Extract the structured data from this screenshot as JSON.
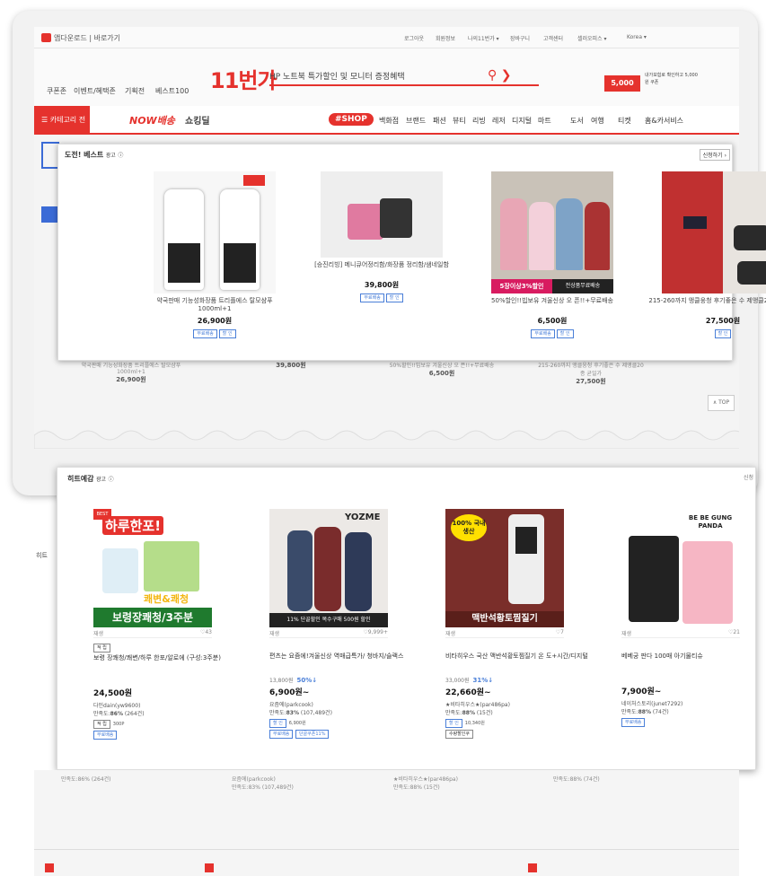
{
  "site": {
    "app_label": "앱다운로드 | 바로가기",
    "top_links": [
      "로그아웃",
      "회원정보",
      "나의11번가 ▾",
      "장바구니",
      "고객센터",
      "셀러오피스 ▾",
      "Korea ▾"
    ],
    "quick_links": [
      "쿠폰존",
      "이벤트/혜택존",
      "기획전",
      "베스트100"
    ],
    "brand": "11번가",
    "promo_text": "HP 노트북 특가할인 및 모니터 증정혜택",
    "coupon_value": "5,000",
    "coupon_text": "내가보험로 확인하고 5,000원 쿠폰",
    "nav": {
      "category_all": "카테고리 전체",
      "now": "NOW배송",
      "shopping": "쇼킹딜",
      "shop_tag": "#SHOP",
      "items": [
        "백화점",
        "브랜드",
        "패션",
        "뷰티",
        "리빙",
        "레저",
        "디지털",
        "마트",
        "도서",
        "여행",
        "티켓",
        "홈&카서비스"
      ]
    },
    "top_button": "∧ TOP"
  },
  "best": {
    "title": "도전! 베스트",
    "ad_label": "광고",
    "apply": "신청하기 ›",
    "items": [
      {
        "name": "약국판매 기능성화장품 트리플에스 탈모샴푸1000ml+1",
        "price": "26,900원",
        "tags": [
          "무료배송",
          "할 인"
        ]
      },
      {
        "name": "[승진리빙] 메니큐어정리함/화장품 정리함/샘네일함",
        "price": "39,800원",
        "tags": [
          "무료배송",
          "할 인"
        ]
      },
      {
        "name": "50%할인!!빕보유 겨울신상 오 픈!!+무료배송",
        "price": "6,500원",
        "tags": [
          "무료배송",
          "할 인"
        ],
        "banner_left": "5장이상3%할인",
        "banner_right": "전상품무료배송"
      },
      {
        "name": "215-260까지 앵클웅청 후기좋은 수 제앵클20종 균일가",
        "price": "27,500원",
        "tags": [
          "할 인"
        ]
      }
    ]
  },
  "hit": {
    "title": "히트예감",
    "ad_label": "광고",
    "apply": "신청",
    "side_label": "히트",
    "items": [
      {
        "img_top": "하루한포!",
        "img_mid": "쾌변&쾌청",
        "img_bottom": "보령장쾌청/3주분",
        "meta_left": "재생",
        "meta_right": "♡43",
        "badge": "적 립",
        "name": "보령 장쾌청/쾌변/하루 한포/알로에 (구성:3주분)",
        "orig": "",
        "pct": "",
        "price": "24,500원",
        "seller": "다인dain(yw9600)",
        "satisfaction_label": "만족도:",
        "satisfaction": "86%",
        "reviews": "(264건)",
        "tag1": "적 립",
        "tag1_note": "300P",
        "tag2": "무료배송",
        "tag2_note": ""
      },
      {
        "img_top": "YOZME",
        "img_mid": "",
        "img_bottom": "11% 단골할인  복수구매 500원 할인",
        "meta_left": "재생",
        "meta_right": "♡9,999+",
        "badge": "",
        "name": "편츠는 요즘에!겨울신상 역매급특가/ 청바지/슬랙스",
        "orig": "13,800원",
        "pct": "50%↓",
        "price": "6,900원~",
        "seller": "요즘에(parkcook)",
        "satisfaction_label": "만족도:",
        "satisfaction": "83%",
        "reviews": "(107,489건)",
        "tag1": "할 인",
        "tag1_note": "6,900원",
        "tag2": "무료배송",
        "tag2_note": "단골쿠폰11%"
      },
      {
        "img_top": "100% 국내생산",
        "img_mid": "",
        "img_bottom": "맥반석황토찜질기",
        "meta_left": "재생",
        "meta_right": "♡7",
        "badge": "",
        "name": "비타히우스 국산 맥반석황토찜질기 온 도+시간/디지털",
        "orig": "33,000원",
        "pct": "31%↓",
        "price": "22,660원~",
        "seller": "★비타히우스★(par486pa)",
        "satisfaction_label": "만족도:",
        "satisfaction": "88%",
        "reviews": "(15건)",
        "tag1": "할 인",
        "tag1_note": "10,340원",
        "tag2": "수량할인쿠",
        "tag2_note": ""
      },
      {
        "img_top": "BE BE GUNG PANDA",
        "img_mid": "",
        "img_bottom": "",
        "meta_left": "재생",
        "meta_right": "♡21",
        "badge": "",
        "name": "베베궁 판다 100매 아기물티슈",
        "orig": "",
        "pct": "",
        "price": "7,900원~",
        "seller": "네이처스토리(junet7292)",
        "satisfaction_label": "만족도:",
        "satisfaction": "88%",
        "reviews": "(74건)",
        "tag1": "무료배송",
        "tag1_note": "",
        "tag2": "",
        "tag2_note": ""
      }
    ]
  },
  "colors": {
    "brand_red": "#e5322d",
    "tag_blue": "#4a7fd8"
  }
}
